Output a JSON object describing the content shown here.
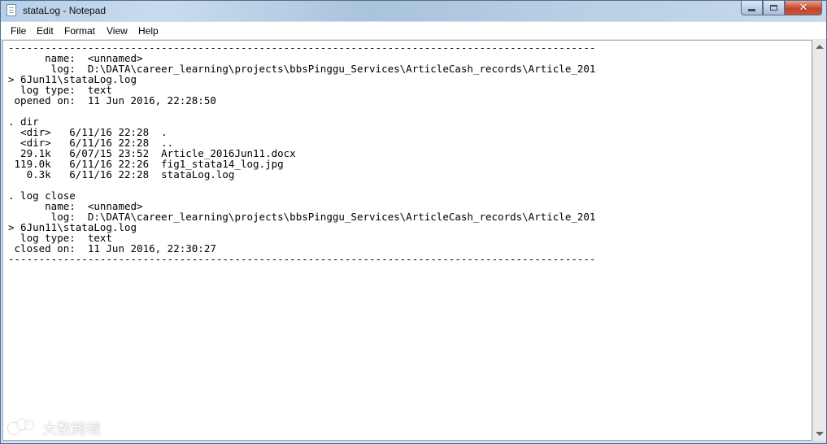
{
  "window": {
    "title": "stataLog - Notepad",
    "close_label": "✕"
  },
  "menu": {
    "file": "File",
    "edit": "Edit",
    "format": "Format",
    "view": "View",
    "help": "Help"
  },
  "document": {
    "lines": [
      "------------------------------------------------------------------------------------------------",
      "      name:  <unnamed>",
      "       log:  D:\\DATA\\career_learning\\projects\\bbsPinggu_Services\\ArticleCash_records\\Article_201",
      "> 6Jun11\\stataLog.log",
      "  log type:  text",
      " opened on:  11 Jun 2016, 22:28:50",
      "",
      ". dir",
      "  <dir>   6/11/16 22:28  .",
      "  <dir>   6/11/16 22:28  ..",
      "  29.1k   6/07/15 23:52  Article_2016Jun11.docx",
      " 119.0k   6/11/16 22:26  fig1_stata14_log.jpg",
      "   0.3k   6/11/16 22:28  stataLog.log",
      "",
      ". log close",
      "      name:  <unnamed>",
      "       log:  D:\\DATA\\career_learning\\projects\\bbsPinggu_Services\\ArticleCash_records\\Article_201",
      "> 6Jun11\\stataLog.log",
      "  log type:  text",
      " closed on:  11 Jun 2016, 22:30:27",
      "------------------------------------------------------------------------------------------------"
    ]
  },
  "watermark": {
    "text": "大数跨境"
  },
  "colors": {
    "titlebar": "#c0d4ea",
    "close_button": "#c7452a",
    "editor_bg": "#ffffff"
  },
  "icons": {
    "app": "notepad-document-icon",
    "minimize": "minimize-icon",
    "maximize": "maximize-icon",
    "close": "close-icon"
  }
}
